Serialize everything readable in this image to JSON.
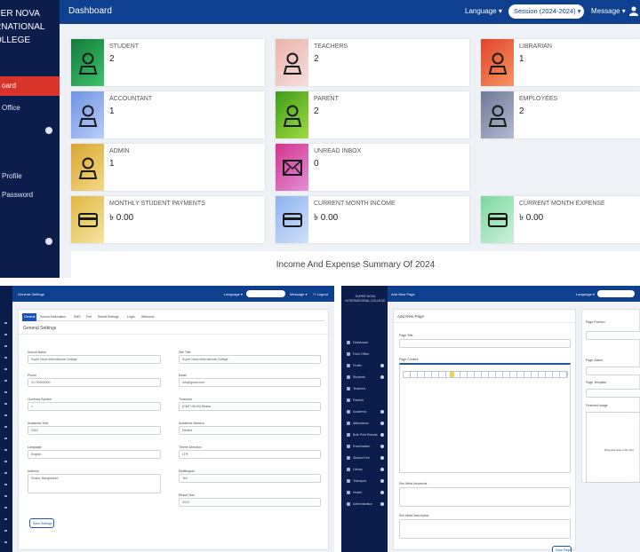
{
  "dashboard": {
    "brand": [
      "PER NOVA",
      "RNATIONAL",
      "OLLEGE"
    ],
    "title": "Dashboard",
    "language": "Language",
    "session": "Session (2024-2024)",
    "message": "Message",
    "sidebar": [
      {
        "label": "oard",
        "active": true
      },
      {
        "label": "Office",
        "active": false
      },
      {
        "label": "Profile",
        "active": false
      },
      {
        "label": "Password",
        "active": false
      }
    ],
    "cards": [
      {
        "label": "STUDENT",
        "value": "2",
        "icon": "user-icon",
        "color": "#1f9a4b"
      },
      {
        "label": "TEACHERS",
        "value": "2",
        "icon": "user-icon",
        "color": "#f0bcbc"
      },
      {
        "label": "LIBRARIAN",
        "value": "1",
        "icon": "user-icon",
        "color": "#f06b3a"
      },
      {
        "label": "ACCOUNTANT",
        "value": "1",
        "icon": "user-icon",
        "color": "#8fb0ee"
      },
      {
        "label": "PARENT",
        "value": "2",
        "icon": "user-icon",
        "color": "#6cc124"
      },
      {
        "label": "EMPLOYEES",
        "value": "2",
        "icon": "user-icon",
        "color": "#8e98b6"
      },
      {
        "label": "ADMIN",
        "value": "1",
        "icon": "user-icon",
        "color": "#e9c45a"
      },
      {
        "label": "UNREAD INBOX",
        "value": "0",
        "icon": "envelope-icon",
        "color": "#c65ab0"
      },
      {
        "label": "MONTHLY STUDENT PAYMENTS",
        "value": "৳ 0.00",
        "icon": "card-icon",
        "color": "#e9c45a"
      },
      {
        "label": "CURRENT MONTH INCOME",
        "value": "৳ 0.00",
        "icon": "card-icon",
        "color": "#a9c4f3"
      },
      {
        "label": "CURRENT MONTH EXPENSE",
        "value": "৳ 0.00",
        "icon": "card-icon",
        "color": "#8fe0a8"
      }
    ],
    "summary_title": "Income And Expense Summary Of 2024"
  },
  "settings": {
    "title": "General Settings",
    "tabs": [
      "General",
      "School Information",
      "SMS",
      "Fee",
      "Result Settings",
      "Login",
      "Welcome"
    ],
    "heading": "General Settings",
    "left_fields": [
      {
        "label": "School Name",
        "value": "Super Nova International College"
      },
      {
        "label": "Phone",
        "value": "01700000000"
      },
      {
        "label": "Currency Symbol",
        "value": "৳"
      },
      {
        "label": "Academic Year",
        "value": "2024"
      },
      {
        "label": "Language",
        "value": "English"
      },
      {
        "label": "Address",
        "value": "Dhaka, Bangladesh"
      }
    ],
    "right_fields": [
      {
        "label": "Site Title",
        "value": "Super Nova International College"
      },
      {
        "label": "Email",
        "value": "info@gmail.com"
      },
      {
        "label": "Timezone",
        "value": "(GMT+06:00) Dhaka"
      },
      {
        "label": "Academic Session",
        "value": "Default"
      },
      {
        "label": "Theme Direction",
        "value": "LTR"
      },
      {
        "label": "Multilingual",
        "value": "Yes"
      },
      {
        "label": "Result Year",
        "value": "2024"
      }
    ],
    "save": "Save Settings"
  },
  "page_editor": {
    "title": "Add New Page",
    "heading": "Add New Page",
    "fields": [
      "Page Title",
      "Page Content",
      "Seo Meta Keywords",
      "Seo Meta Description"
    ],
    "side_fields": [
      "Page Position",
      "Page Status",
      "Page Template",
      "Featured Image"
    ],
    "upload_hint": "Drag and drop a file here",
    "save": "Save Page",
    "sidebar": [
      "Dashboard",
      "Front Office",
      "Profile",
      "Students",
      "Teachers",
      "Parents",
      "Academic",
      "Attendance",
      "Bulk Print Results",
      "Examination",
      "Student Fee",
      "Library",
      "Transport",
      "Hostel",
      "Administration"
    ]
  }
}
